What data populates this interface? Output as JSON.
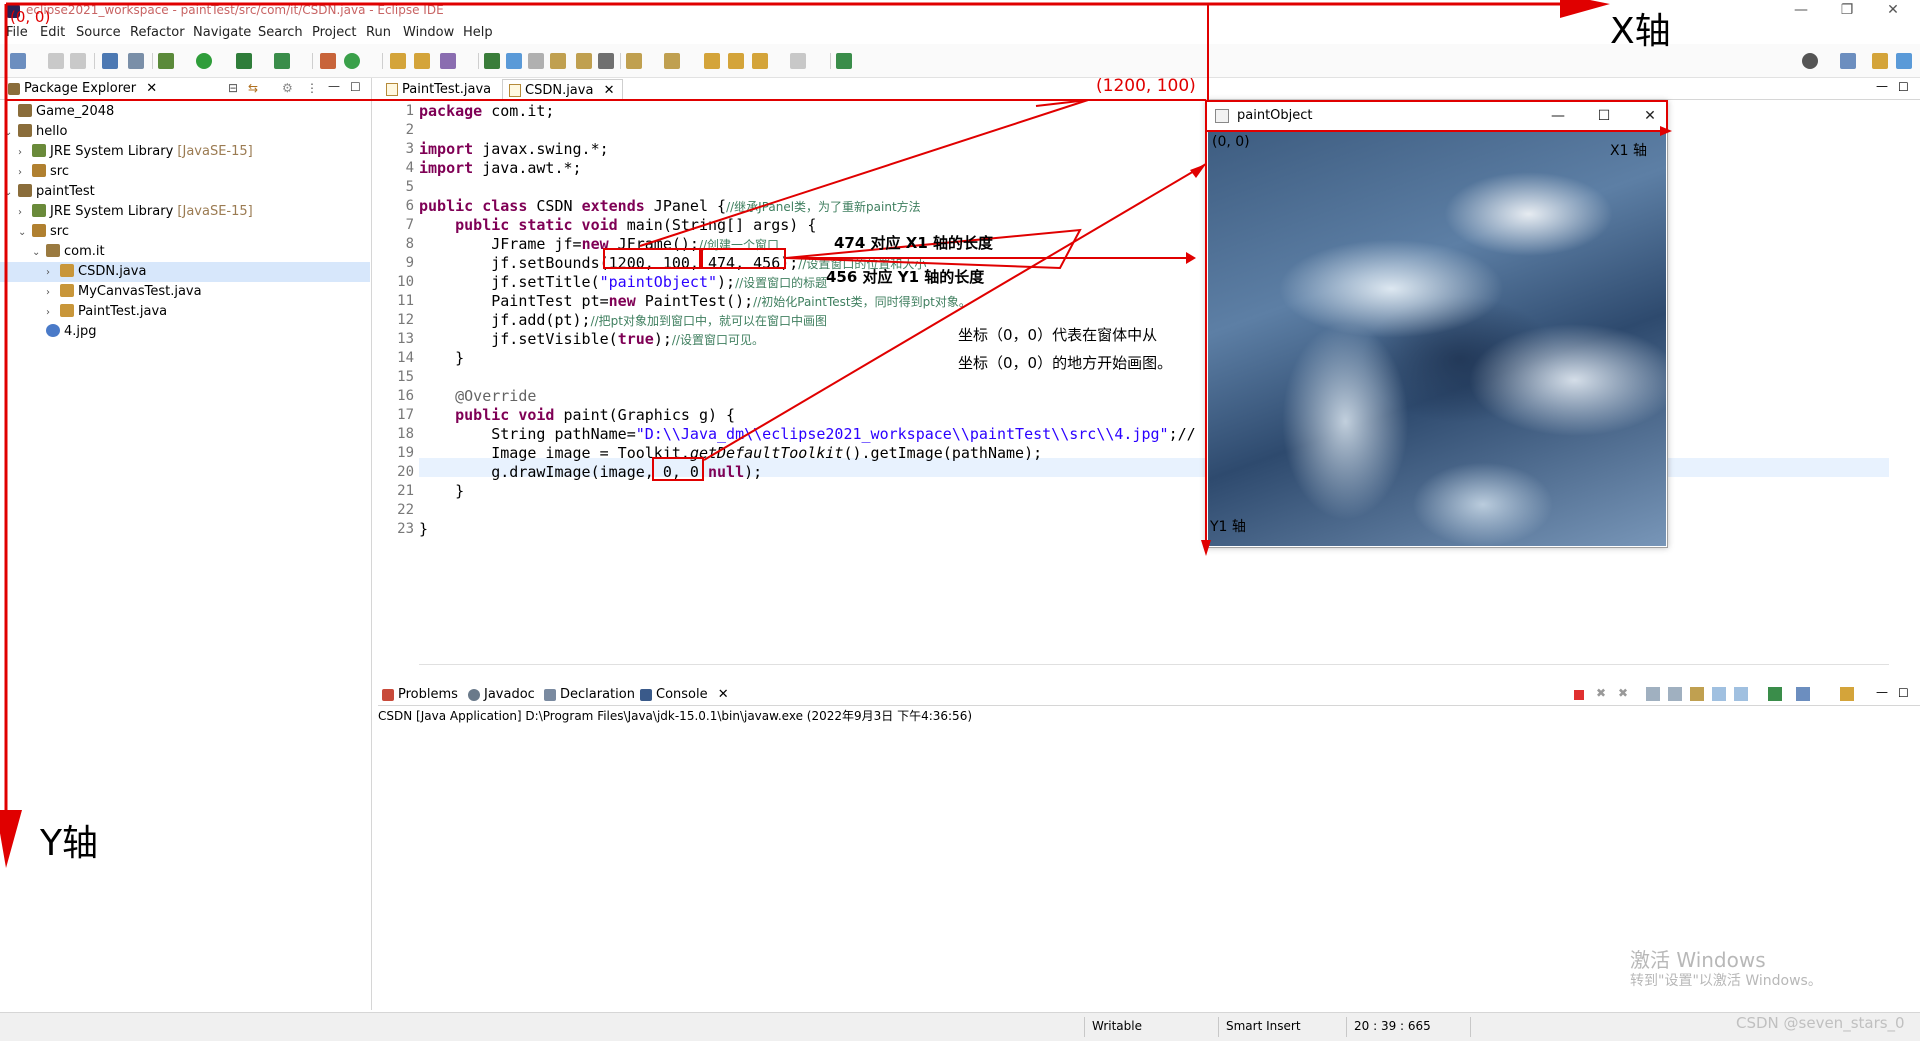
{
  "window": {
    "title": "eclipse2021_workspace - paintTest/src/com/it/CSDN.java - Eclipse IDE",
    "minimize": "—",
    "restore": "❐",
    "close": "✕"
  },
  "menu": [
    "File",
    "Edit",
    "Source",
    "Refactor",
    "Navigate",
    "Search",
    "Project",
    "Run",
    "Window",
    "Help"
  ],
  "package_explorer": {
    "tab_label": "Package Explorer",
    "tree": [
      {
        "label": "Game_2048",
        "depth": 0,
        "expanded": false,
        "icon": "project-icon"
      },
      {
        "label": "hello",
        "depth": 0,
        "expanded": true,
        "icon": "project-icon"
      },
      {
        "label": "JRE System Library",
        "suffix": "[JavaSE-15]",
        "depth": 1,
        "expanded": false,
        "icon": "library-icon"
      },
      {
        "label": "src",
        "depth": 1,
        "expanded": false,
        "icon": "source-folder-icon"
      },
      {
        "label": "paintTest",
        "depth": 0,
        "expanded": true,
        "icon": "project-icon"
      },
      {
        "label": "JRE System Library",
        "suffix": "[JavaSE-15]",
        "depth": 1,
        "expanded": false,
        "icon": "library-icon"
      },
      {
        "label": "src",
        "depth": 1,
        "expanded": true,
        "icon": "source-folder-icon"
      },
      {
        "label": "com.it",
        "depth": 2,
        "expanded": true,
        "icon": "package-icon"
      },
      {
        "label": "CSDN.java",
        "depth": 3,
        "expanded": false,
        "icon": "java-file-icon",
        "selected": true
      },
      {
        "label": "MyCanvasTest.java",
        "depth": 3,
        "expanded": false,
        "icon": "java-file-icon"
      },
      {
        "label": "PaintTest.java",
        "depth": 3,
        "expanded": false,
        "icon": "java-file-icon"
      },
      {
        "label": "4.jpg",
        "depth": 2,
        "expanded": null,
        "icon": "image-file-icon"
      }
    ]
  },
  "editor": {
    "tabs": [
      {
        "label": "PaintTest.java",
        "active": false
      },
      {
        "label": "CSDN.java",
        "active": true
      }
    ],
    "lines": [
      {
        "n": "1",
        "html": "<span class='kw'>package</span> com.it;"
      },
      {
        "n": "2",
        "html": ""
      },
      {
        "n": "3",
        "html": "<span class='kw'>import</span> javax.swing.*;"
      },
      {
        "n": "4",
        "html": "<span class='kw'>import</span> java.awt.*;"
      },
      {
        "n": "5",
        "html": ""
      },
      {
        "n": "6",
        "html": "<span class='kw'>public class</span> CSDN <span class='kw'>extends</span> JPanel {<span class='cmt'>//继承JPanel类，为了重新paint方法</span>"
      },
      {
        "n": "7",
        "html": "    <span class='kw'>public static void</span> main(String[] args) {"
      },
      {
        "n": "8",
        "html": "        JFrame jf=<span class='kw'>new</span> JFrame();<span class='cmt'>//创建一个窗口</span>"
      },
      {
        "n": "9",
        "html": "        jf.setBounds(1200, 100, 474, 456);<span class='cmt'>//设置窗口的位置和大小</span>"
      },
      {
        "n": "10",
        "html": "        jf.setTitle(<span class='str'>\"paintObject\"</span>);<span class='cmt'>//设置窗口的标题</span>"
      },
      {
        "n": "11",
        "html": "        PaintTest pt=<span class='kw'>new</span> PaintTest();<span class='cmt'>//初始化PaintTest类，同时得到pt对象。</span>"
      },
      {
        "n": "12",
        "html": "        jf.add(pt);<span class='cmt'>//把pt对象加到窗口中，就可以在窗口中画图</span>"
      },
      {
        "n": "13",
        "html": "        jf.setVisible(<span class='kw'>true</span>);<span class='cmt'>//设置窗口可见。</span>"
      },
      {
        "n": "14",
        "html": "    }"
      },
      {
        "n": "15",
        "html": ""
      },
      {
        "n": "16",
        "html": "    <span class='ann'>@Override</span>"
      },
      {
        "n": "17",
        "html": "    <span class='kw'>public void</span> paint(Graphics g) {"
      },
      {
        "n": "18",
        "html": "        String pathName=<span class='str'>\"D:\\\\Java_dm\\\\eclipse2021_workspace\\\\paintTest\\\\src\\\\4.jpg\"</span>;//"
      },
      {
        "n": "19",
        "html": "        Image image = Toolkit.<i>getDefaultToolkit</i>().getImage(pathName);"
      },
      {
        "n": "20",
        "html": "        g.drawImage(image, 0, 0 <span class='kw'>null</span>);"
      },
      {
        "n": "21",
        "html": "    }"
      },
      {
        "n": "22",
        "html": ""
      },
      {
        "n": "23",
        "html": "}"
      }
    ]
  },
  "console": {
    "tabs": [
      {
        "label": "Problems",
        "icon": "problems-icon"
      },
      {
        "label": "Javadoc",
        "icon": "javadoc-icon"
      },
      {
        "label": "Declaration",
        "icon": "declaration-icon"
      },
      {
        "label": "Console",
        "icon": "console-icon"
      }
    ],
    "info": "CSDN [Java Application] D:\\Program Files\\Java\\jdk-15.0.1\\bin\\javaw.exe  (2022年9月3日 下午4:36:56)"
  },
  "status": {
    "writable": "Writable",
    "insert_mode": "Smart Insert",
    "position": "20 : 39 : 665"
  },
  "paint_window": {
    "title": "paintObject",
    "minimize": "—",
    "maximize": "☐",
    "close": "✕"
  },
  "annotations": {
    "origin_main": "(0, 0)",
    "x_axis": "X轴",
    "y_axis": "Y轴",
    "window_pos": "(1200, 100)",
    "origin_window": "(0, 0)",
    "x1_axis": "X1 轴",
    "y1_axis": "Y1 轴",
    "x1_length": "474 对应 X1 轴的长度",
    "y1_length": "456 对应 Y1 轴的长度",
    "coord_note_1": "坐标（0，0）代表在窗体中从",
    "coord_note_2": "坐标（0，0）的地方开始画图。",
    "accent": "#e00000"
  },
  "watermarks": {
    "activate_1": "激活 Windows",
    "activate_2": "转到\"设置\"以激活 Windows。",
    "csdn": "CSDN @seven_stars_0"
  }
}
